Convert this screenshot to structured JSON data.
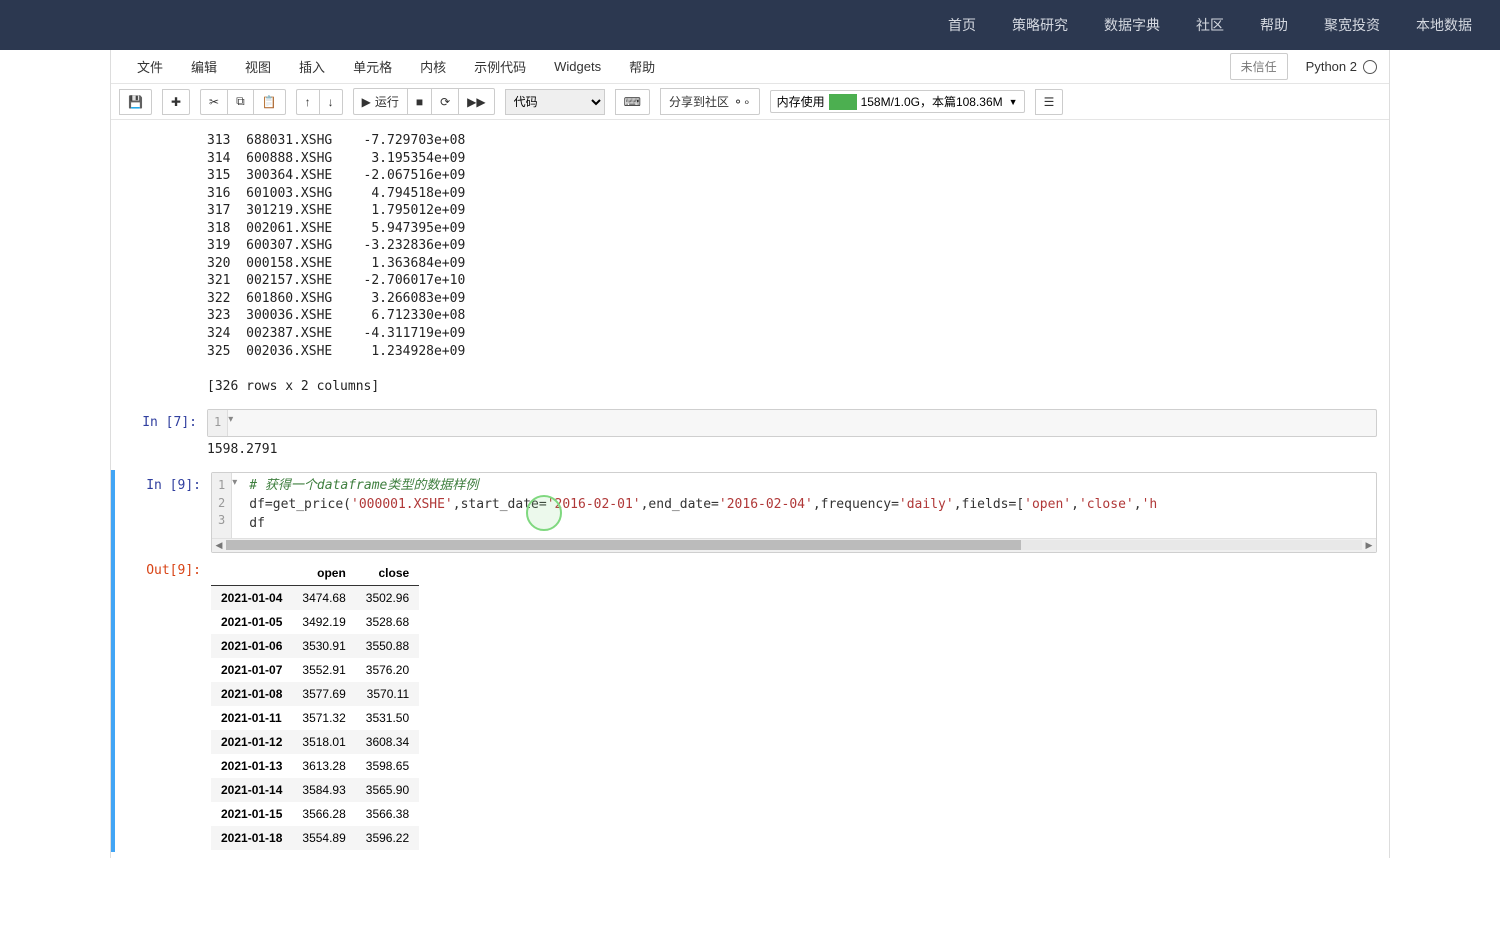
{
  "top_nav": [
    "首页",
    "策略研究",
    "数据字典",
    "社区",
    "帮助",
    "聚宽投资",
    "本地数据"
  ],
  "menubar": {
    "items": [
      "文件",
      "编辑",
      "视图",
      "插入",
      "单元格",
      "内核",
      "示例代码",
      "Widgets",
      "帮助"
    ],
    "trust": "未信任",
    "kernel": "Python 2"
  },
  "toolbar": {
    "run": "运行",
    "cell_type": "代码",
    "share": "分享到社区",
    "mem_label": "内存使用",
    "mem_text": "158M/1.0G，本篇108.36M"
  },
  "output_text": {
    "rows": [
      {
        "i": "313",
        "code": "688031.XSHG",
        "val": "-7.729703e+08"
      },
      {
        "i": "314",
        "code": "600888.XSHG",
        "val": " 3.195354e+09"
      },
      {
        "i": "315",
        "code": "300364.XSHE",
        "val": "-2.067516e+09"
      },
      {
        "i": "316",
        "code": "601003.XSHG",
        "val": " 4.794518e+09"
      },
      {
        "i": "317",
        "code": "301219.XSHE",
        "val": " 1.795012e+09"
      },
      {
        "i": "318",
        "code": "002061.XSHE",
        "val": " 5.947395e+09"
      },
      {
        "i": "319",
        "code": "600307.XSHG",
        "val": "-3.232836e+09"
      },
      {
        "i": "320",
        "code": "000158.XSHE",
        "val": " 1.363684e+09"
      },
      {
        "i": "321",
        "code": "002157.XSHE",
        "val": "-2.706017e+10"
      },
      {
        "i": "322",
        "code": "601860.XSHG",
        "val": " 3.266083e+09"
      },
      {
        "i": "323",
        "code": "300036.XSHE",
        "val": " 6.712330e+08"
      },
      {
        "i": "324",
        "code": "002387.XSHE",
        "val": "-4.311719e+09"
      },
      {
        "i": "325",
        "code": "002036.XSHE",
        "val": " 1.234928e+09"
      }
    ],
    "footer": "[326 rows x 2 columns]"
  },
  "cell7": {
    "prompt": "In  [7]:",
    "line": "1",
    "output": "1598.2791"
  },
  "cell9": {
    "prompt": "In  [9]:",
    "comment": "# 获得一个dataframe类型的数据样例",
    "code_plain": "df=get_price(",
    "str1": "'000001.XSHE'",
    "mid1": ",start_date=",
    "str2": "'2016-02-01'",
    "mid2": ",end_date=",
    "str3": "'2016-02-04'",
    "mid3": ",frequency=",
    "str4": "'daily'",
    "mid4": ",fields=[",
    "str5": "'open'",
    "mid5": ",",
    "str6": "'close'",
    "mid6": ",",
    "str7": "'h",
    "line3": "df",
    "out_prompt": "Out[9]:"
  },
  "df": {
    "cols": [
      "open",
      "close"
    ],
    "rows": [
      {
        "idx": "2021-01-04",
        "open": "3474.68",
        "close": "3502.96"
      },
      {
        "idx": "2021-01-05",
        "open": "3492.19",
        "close": "3528.68"
      },
      {
        "idx": "2021-01-06",
        "open": "3530.91",
        "close": "3550.88"
      },
      {
        "idx": "2021-01-07",
        "open": "3552.91",
        "close": "3576.20"
      },
      {
        "idx": "2021-01-08",
        "open": "3577.69",
        "close": "3570.11"
      },
      {
        "idx": "2021-01-11",
        "open": "3571.32",
        "close": "3531.50"
      },
      {
        "idx": "2021-01-12",
        "open": "3518.01",
        "close": "3608.34"
      },
      {
        "idx": "2021-01-13",
        "open": "3613.28",
        "close": "3598.65"
      },
      {
        "idx": "2021-01-14",
        "open": "3584.93",
        "close": "3565.90"
      },
      {
        "idx": "2021-01-15",
        "open": "3566.28",
        "close": "3566.38"
      },
      {
        "idx": "2021-01-18",
        "open": "3554.89",
        "close": "3596.22"
      }
    ]
  }
}
